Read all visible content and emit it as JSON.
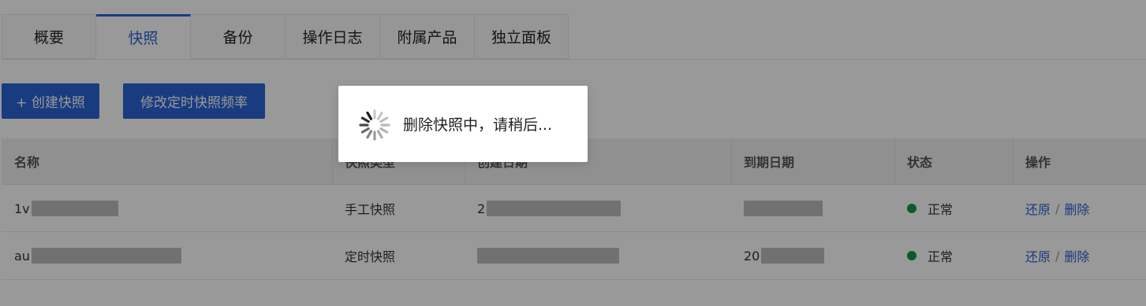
{
  "tabs": [
    {
      "label": "概要"
    },
    {
      "label": "快照"
    },
    {
      "label": "备份"
    },
    {
      "label": "操作日志"
    },
    {
      "label": "附属产品"
    },
    {
      "label": "独立面板"
    }
  ],
  "toolbar": {
    "create_label": "+ 创建快照",
    "schedule_label": "修改定时快照频率"
  },
  "table": {
    "headers": [
      "名称",
      "快照类型",
      "创建日期",
      "到期日期",
      "状态",
      "操作"
    ],
    "rows": [
      {
        "name_prefix": "1v",
        "type": "手工快照",
        "created_prefix": "2",
        "expires_prefix": "",
        "status": "正常",
        "restore": "还原",
        "separator": "/",
        "delete": "删除"
      },
      {
        "name_prefix": "au",
        "type": "定时快照",
        "created_prefix": "",
        "expires_prefix": "20",
        "status": "正常",
        "restore": "还原",
        "separator": "/",
        "delete": "删除"
      }
    ]
  },
  "loading": {
    "message": "删除快照中，请稍后...",
    "icon": "spinner-icon"
  },
  "colors": {
    "accent": "#2a63d6",
    "status_ok": "#0a9b4a"
  }
}
